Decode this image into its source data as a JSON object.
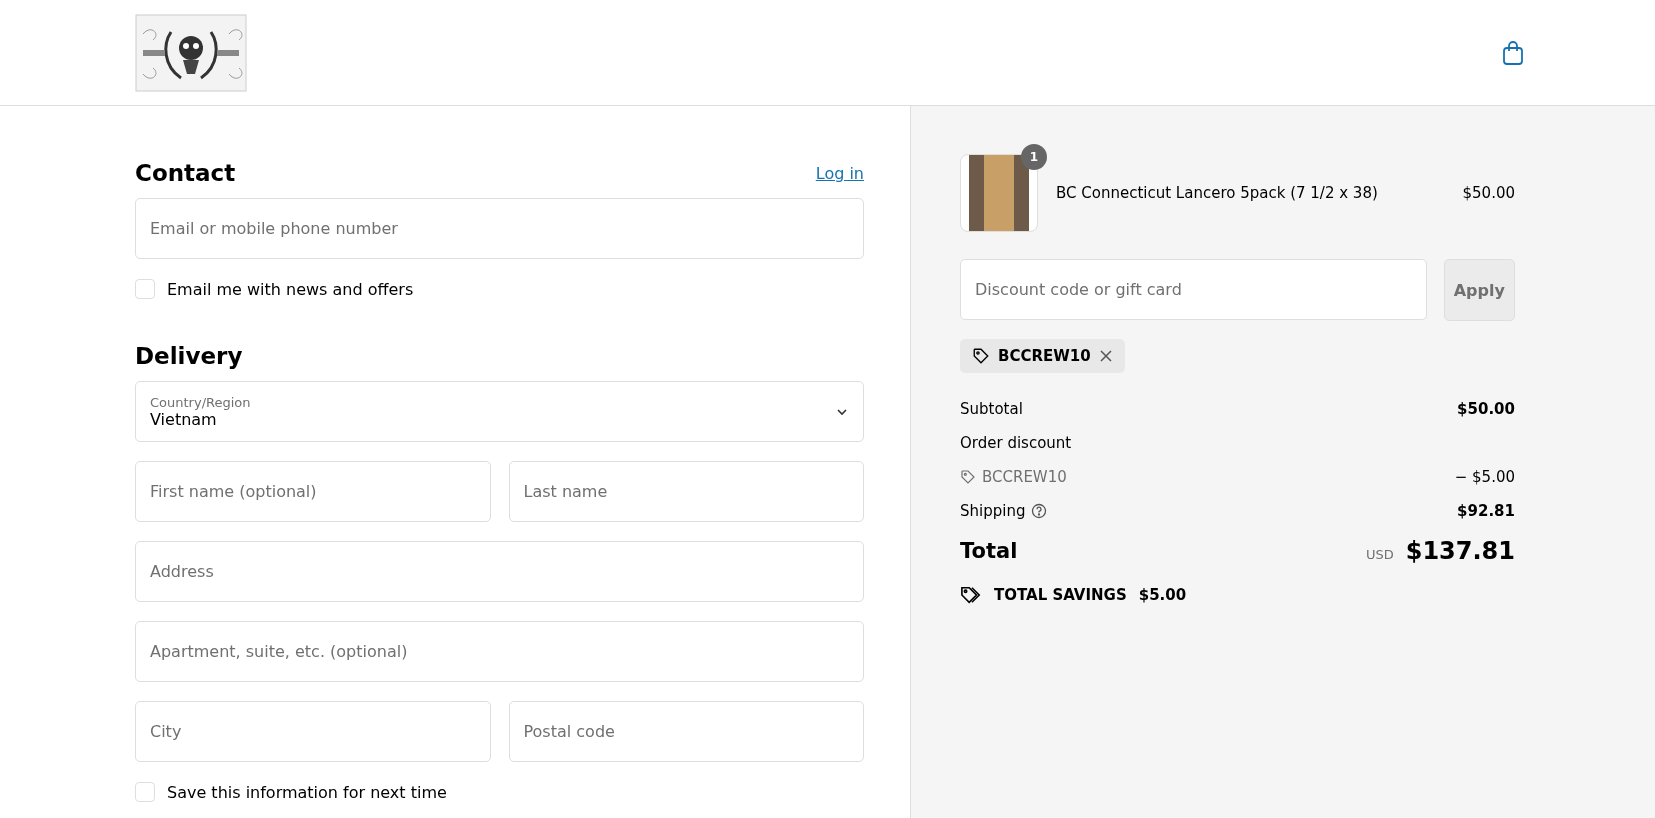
{
  "contact": {
    "title": "Contact",
    "login_link": "Log in",
    "email": {
      "placeholder": "Email or mobile phone number"
    },
    "newsletter": {
      "label": "Email me with news and offers",
      "checked": false
    }
  },
  "delivery": {
    "title": "Delivery",
    "country": {
      "label": "Country/Region",
      "value": "Vietnam"
    },
    "fields": [
      [
        {
          "placeholder": "First name (optional)"
        },
        {
          "placeholder": "Last name"
        }
      ],
      [
        {
          "placeholder": "Address"
        }
      ],
      [
        {
          "placeholder": "Apartment, suite, etc. (optional)"
        }
      ],
      [
        {
          "placeholder": "City"
        },
        {
          "placeholder": "Postal code"
        }
      ]
    ],
    "save_info": {
      "label": "Save this information for next time",
      "checked": false
    }
  },
  "summary": {
    "items": [
      {
        "name": "BC Connecticut Lancero 5pack (7 1/2 x 38)",
        "quantity": "1",
        "price": "$50.00"
      }
    ],
    "discount": {
      "placeholder": "Discount code or gift card",
      "button": "Apply"
    },
    "applied_codes": [
      {
        "code": "BCCREW10"
      }
    ],
    "lines": [
      {
        "kind": "plain",
        "label": "Subtotal",
        "value": "$50.00"
      },
      {
        "kind": "plain",
        "label": "Order discount"
      },
      {
        "kind": "code",
        "label": "BCCREW10",
        "value": "− $5.00"
      },
      {
        "kind": "help",
        "label": "Shipping",
        "value": "$92.81"
      }
    ],
    "total": {
      "label": "Total",
      "currency": "USD",
      "value": "$137.81"
    },
    "savings": {
      "label": "TOTAL SAVINGS",
      "value": "$5.00"
    }
  }
}
